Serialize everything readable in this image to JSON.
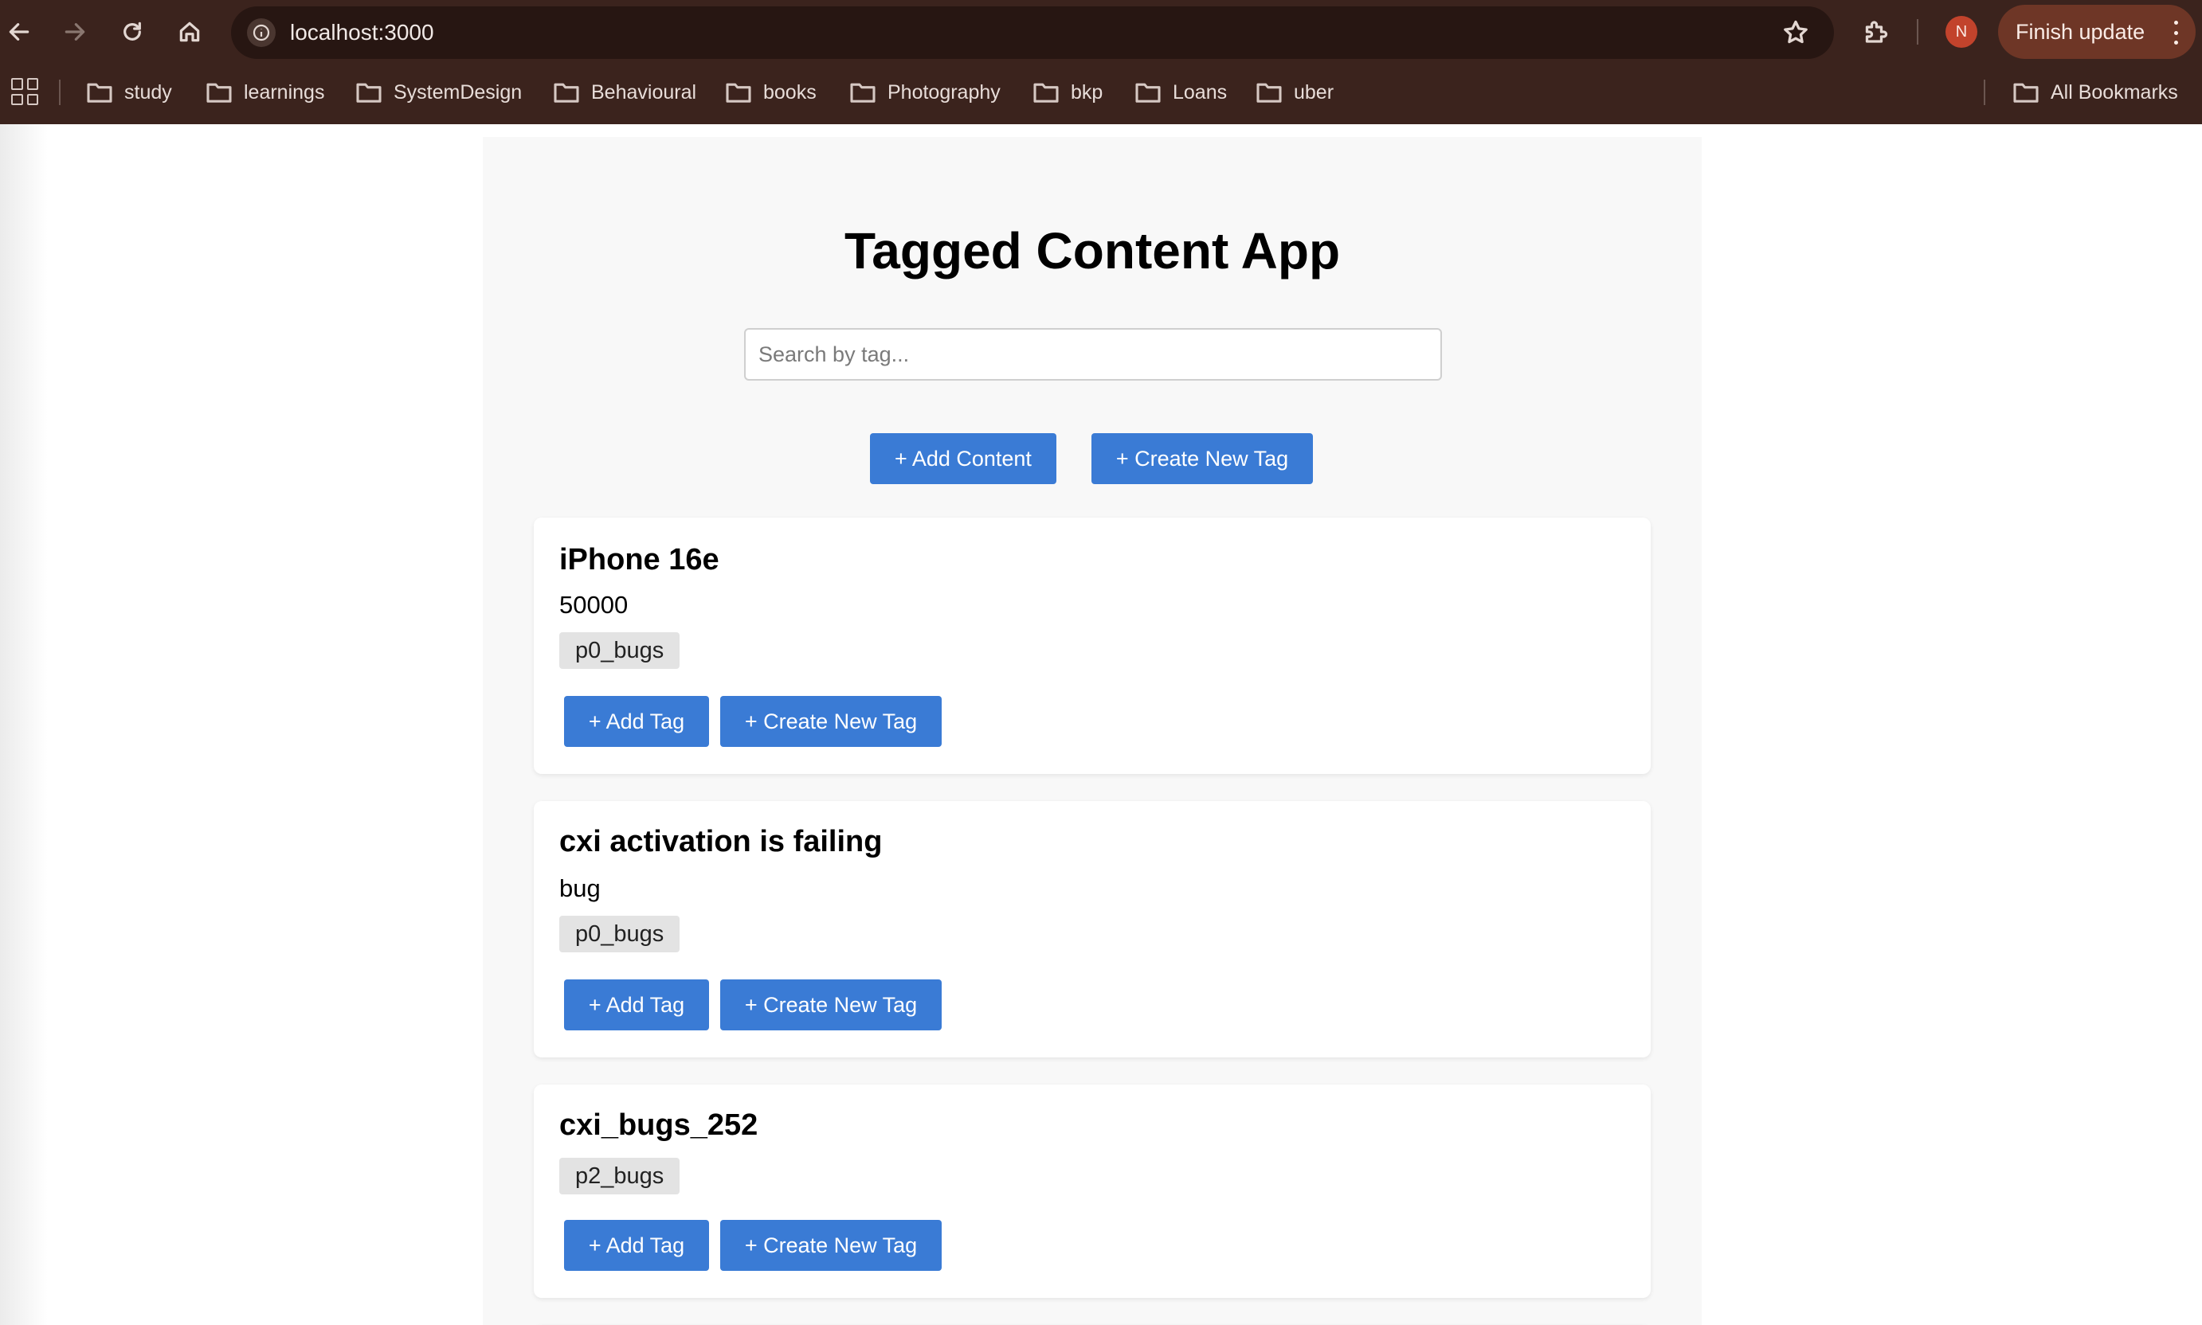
{
  "browser": {
    "url": "localhost:3000",
    "profile_initial": "N",
    "update_label": "Finish update",
    "bookmarks": [
      "study",
      "learnings",
      "SystemDesign",
      "Behavioural",
      "books",
      "Photography",
      "bkp",
      "Loans",
      "uber"
    ],
    "all_bookmarks_label": "All Bookmarks"
  },
  "app": {
    "title": "Tagged Content App",
    "search_placeholder": "Search by tag...",
    "add_content_label": "+ Add Content",
    "create_tag_label": "+ Create New Tag"
  },
  "cards": [
    {
      "title": "iPhone 16e",
      "description": "50000",
      "tags": [
        "p0_bugs"
      ],
      "add_tag_label": "+ Add Tag",
      "create_tag_label": "+ Create New Tag"
    },
    {
      "title": "cxi activation is failing",
      "description": "bug",
      "tags": [
        "p0_bugs"
      ],
      "add_tag_label": "+ Add Tag",
      "create_tag_label": "+ Create New Tag"
    },
    {
      "title": "cxi_bugs_252",
      "description": "",
      "tags": [
        "p2_bugs"
      ],
      "add_tag_label": "+ Add Tag",
      "create_tag_label": "+ Create New Tag"
    }
  ],
  "colors": {
    "primary_button": "#3a7bd5",
    "chrome": "#3b231d",
    "tag_bg": "#e3e3e3"
  }
}
